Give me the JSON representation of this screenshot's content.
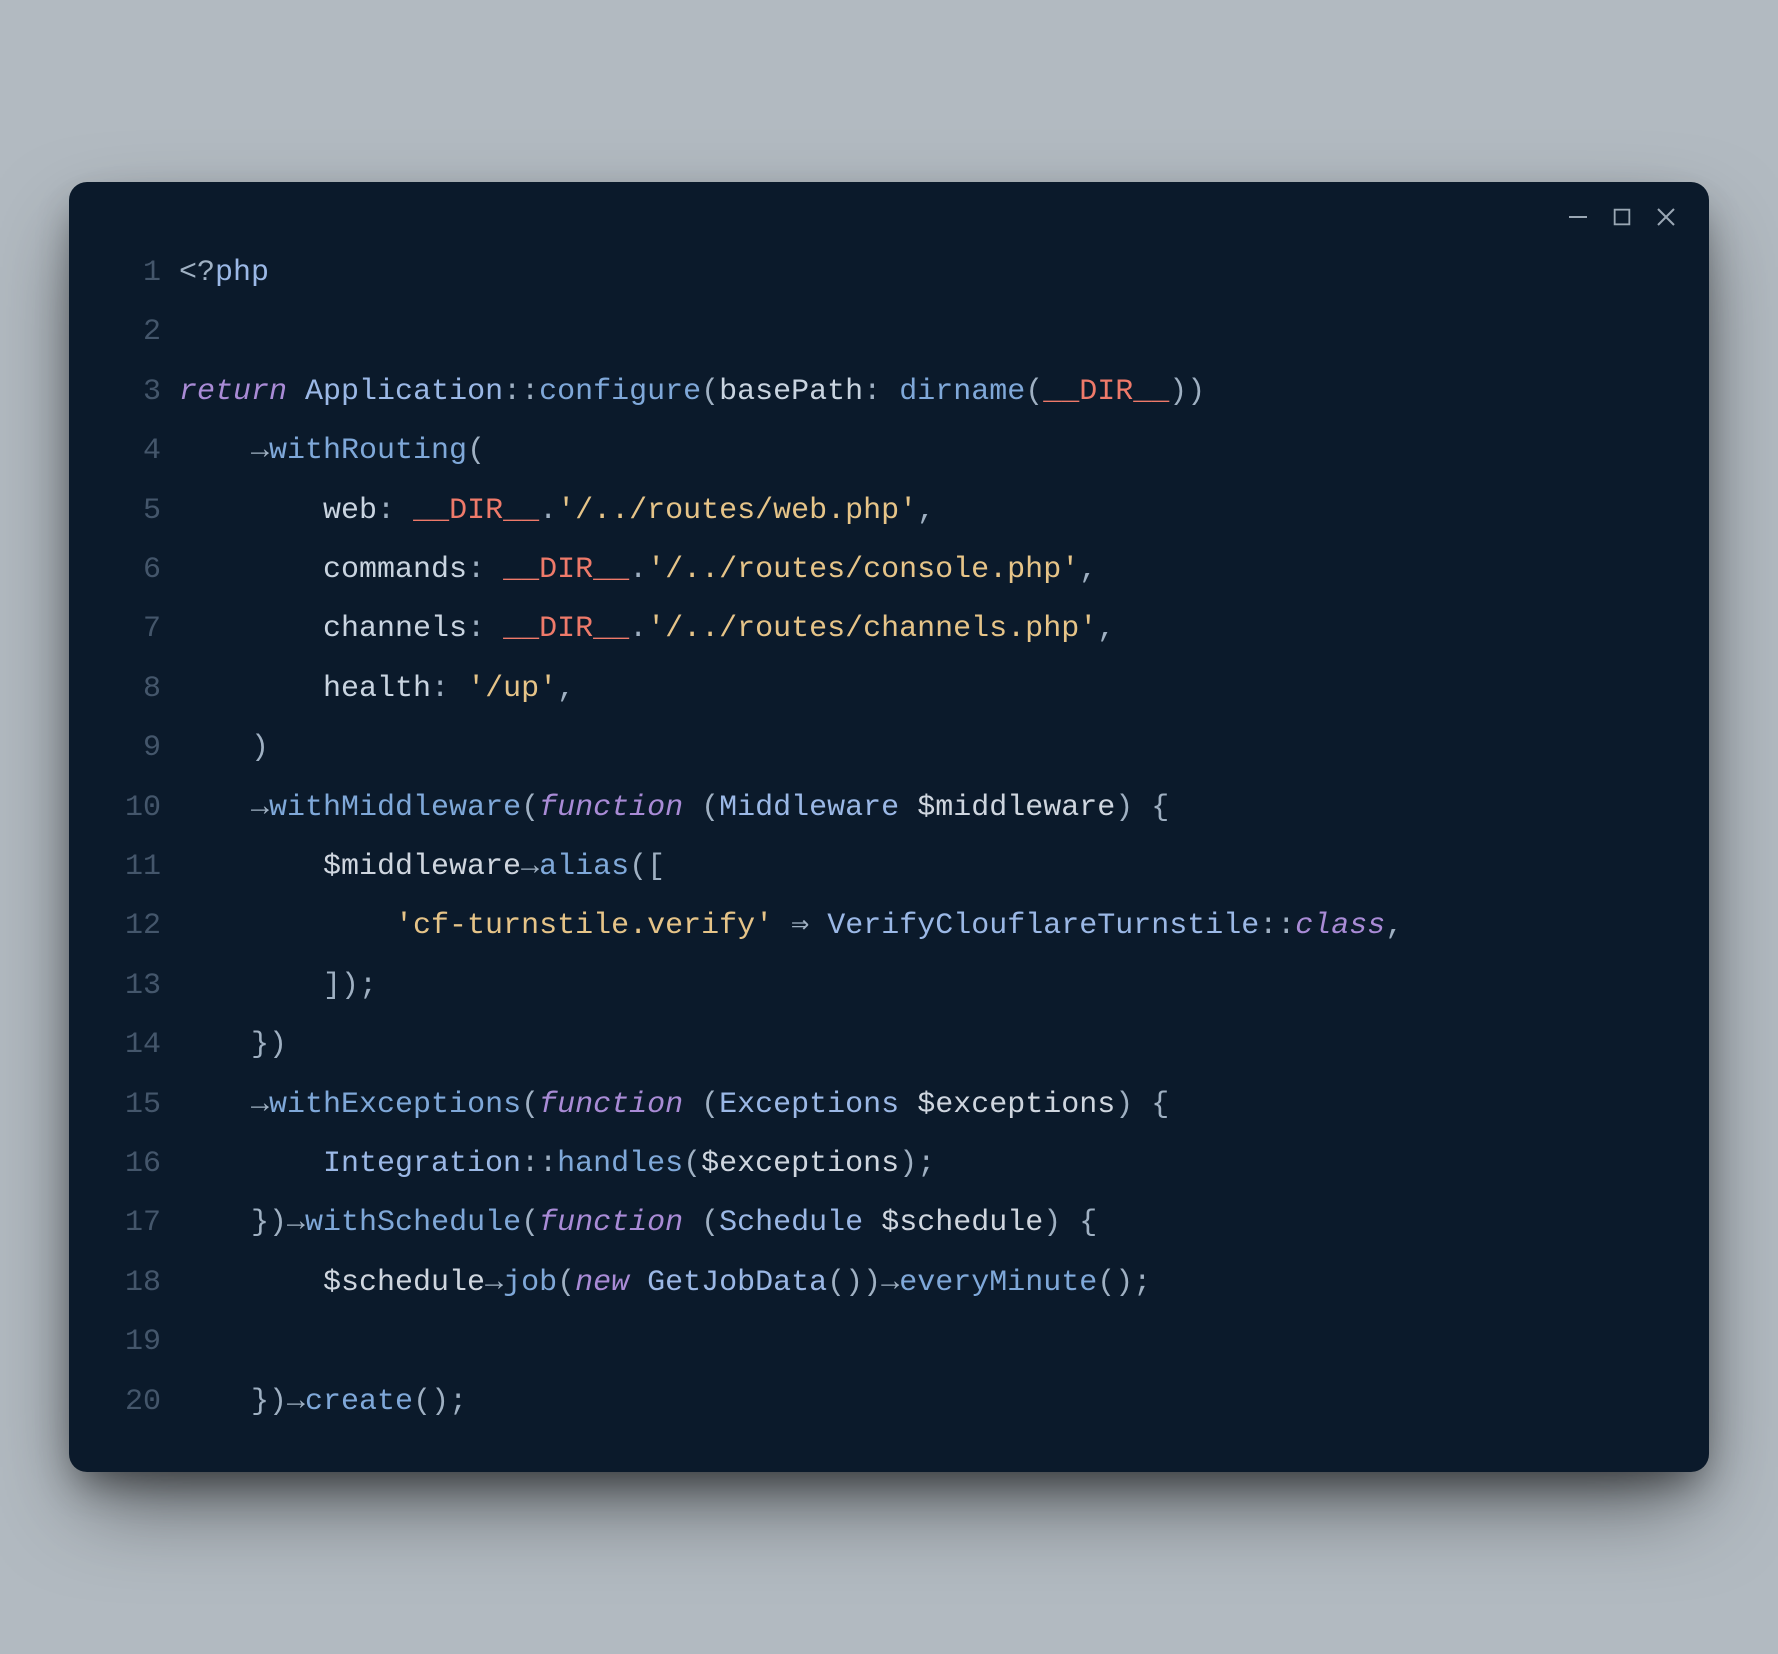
{
  "window": {
    "controls": {
      "minimize": "minimize",
      "maximize": "maximize",
      "close": "close"
    }
  },
  "code": {
    "lines": [
      {
        "n": "1",
        "t": [
          [
            "punc",
            "<?"
          ],
          [
            "type",
            "php"
          ]
        ]
      },
      {
        "n": "2",
        "t": []
      },
      {
        "n": "3",
        "t": [
          [
            "kw",
            "return"
          ],
          [
            "punc",
            " "
          ],
          [
            "type",
            "Application"
          ],
          [
            "punc",
            "::"
          ],
          [
            "fn",
            "configure"
          ],
          [
            "punc",
            "("
          ],
          [
            "named",
            "basePath"
          ],
          [
            "punc",
            ": "
          ],
          [
            "fn",
            "dirname"
          ],
          [
            "punc",
            "("
          ],
          [
            "const",
            "__DIR__"
          ],
          [
            "punc",
            "))"
          ]
        ]
      },
      {
        "n": "4",
        "t": [
          [
            "punc",
            "    "
          ],
          [
            "arrow",
            "→"
          ],
          [
            "fn",
            "withRouting"
          ],
          [
            "punc",
            "("
          ]
        ]
      },
      {
        "n": "5",
        "t": [
          [
            "punc",
            "        "
          ],
          [
            "named",
            "web"
          ],
          [
            "punc",
            ": "
          ],
          [
            "const",
            "__DIR__"
          ],
          [
            "punc",
            "."
          ],
          [
            "str",
            "'/../routes/web.php'"
          ],
          [
            "punc",
            ","
          ]
        ]
      },
      {
        "n": "6",
        "t": [
          [
            "punc",
            "        "
          ],
          [
            "named",
            "commands"
          ],
          [
            "punc",
            ": "
          ],
          [
            "const",
            "__DIR__"
          ],
          [
            "punc",
            "."
          ],
          [
            "str",
            "'/../routes/console.php'"
          ],
          [
            "punc",
            ","
          ]
        ]
      },
      {
        "n": "7",
        "t": [
          [
            "punc",
            "        "
          ],
          [
            "named",
            "channels"
          ],
          [
            "punc",
            ": "
          ],
          [
            "const",
            "__DIR__"
          ],
          [
            "punc",
            "."
          ],
          [
            "str",
            "'/../routes/channels.php'"
          ],
          [
            "punc",
            ","
          ]
        ]
      },
      {
        "n": "8",
        "t": [
          [
            "punc",
            "        "
          ],
          [
            "named",
            "health"
          ],
          [
            "punc",
            ": "
          ],
          [
            "str",
            "'/up'"
          ],
          [
            "punc",
            ","
          ]
        ]
      },
      {
        "n": "9",
        "t": [
          [
            "punc",
            "    )"
          ]
        ]
      },
      {
        "n": "10",
        "t": [
          [
            "punc",
            "    "
          ],
          [
            "arrow",
            "→"
          ],
          [
            "fn",
            "withMiddleware"
          ],
          [
            "punc",
            "("
          ],
          [
            "kw",
            "function"
          ],
          [
            "punc",
            " ("
          ],
          [
            "type",
            "Middleware"
          ],
          [
            "punc",
            " "
          ],
          [
            "var",
            "$middleware"
          ],
          [
            "punc",
            ") {"
          ]
        ]
      },
      {
        "n": "11",
        "t": [
          [
            "punc",
            "        "
          ],
          [
            "var",
            "$middleware"
          ],
          [
            "arrow",
            "→"
          ],
          [
            "fn",
            "alias"
          ],
          [
            "punc",
            "(["
          ]
        ]
      },
      {
        "n": "12",
        "t": [
          [
            "punc",
            "            "
          ],
          [
            "str",
            "'cf-turnstile.verify'"
          ],
          [
            "punc",
            " "
          ],
          [
            "arrow",
            "⇒"
          ],
          [
            "punc",
            " "
          ],
          [
            "type",
            "VerifyClouflareTurnstile"
          ],
          [
            "punc",
            "::"
          ],
          [
            "classkw",
            "class"
          ],
          [
            "punc",
            ","
          ]
        ]
      },
      {
        "n": "13",
        "t": [
          [
            "punc",
            "        ]);"
          ]
        ]
      },
      {
        "n": "14",
        "t": [
          [
            "punc",
            "    })"
          ]
        ]
      },
      {
        "n": "15",
        "t": [
          [
            "punc",
            "    "
          ],
          [
            "arrow",
            "→"
          ],
          [
            "fn",
            "withExceptions"
          ],
          [
            "punc",
            "("
          ],
          [
            "kw",
            "function"
          ],
          [
            "punc",
            " ("
          ],
          [
            "type",
            "Exceptions"
          ],
          [
            "punc",
            " "
          ],
          [
            "var",
            "$exceptions"
          ],
          [
            "punc",
            ") {"
          ]
        ]
      },
      {
        "n": "16",
        "t": [
          [
            "punc",
            "        "
          ],
          [
            "type",
            "Integration"
          ],
          [
            "punc",
            "::"
          ],
          [
            "fn",
            "handles"
          ],
          [
            "punc",
            "("
          ],
          [
            "var",
            "$exceptions"
          ],
          [
            "punc",
            ");"
          ]
        ]
      },
      {
        "n": "17",
        "t": [
          [
            "punc",
            "    })"
          ],
          [
            "arrow",
            "→"
          ],
          [
            "fn",
            "withSchedule"
          ],
          [
            "punc",
            "("
          ],
          [
            "kw",
            "function"
          ],
          [
            "punc",
            " ("
          ],
          [
            "type",
            "Schedule"
          ],
          [
            "punc",
            " "
          ],
          [
            "var",
            "$schedule"
          ],
          [
            "punc",
            ") {"
          ]
        ]
      },
      {
        "n": "18",
        "t": [
          [
            "punc",
            "        "
          ],
          [
            "var",
            "$schedule"
          ],
          [
            "arrow",
            "→"
          ],
          [
            "fn",
            "job"
          ],
          [
            "punc",
            "("
          ],
          [
            "kw",
            "new"
          ],
          [
            "punc",
            " "
          ],
          [
            "type",
            "GetJobData"
          ],
          [
            "punc",
            "())"
          ],
          [
            "arrow",
            "→"
          ],
          [
            "fn",
            "everyMinute"
          ],
          [
            "punc",
            "();"
          ]
        ]
      },
      {
        "n": "19",
        "t": []
      },
      {
        "n": "20",
        "t": [
          [
            "punc",
            "    })"
          ],
          [
            "arrow",
            "→"
          ],
          [
            "fn",
            "create"
          ],
          [
            "punc",
            "();"
          ]
        ]
      }
    ]
  }
}
